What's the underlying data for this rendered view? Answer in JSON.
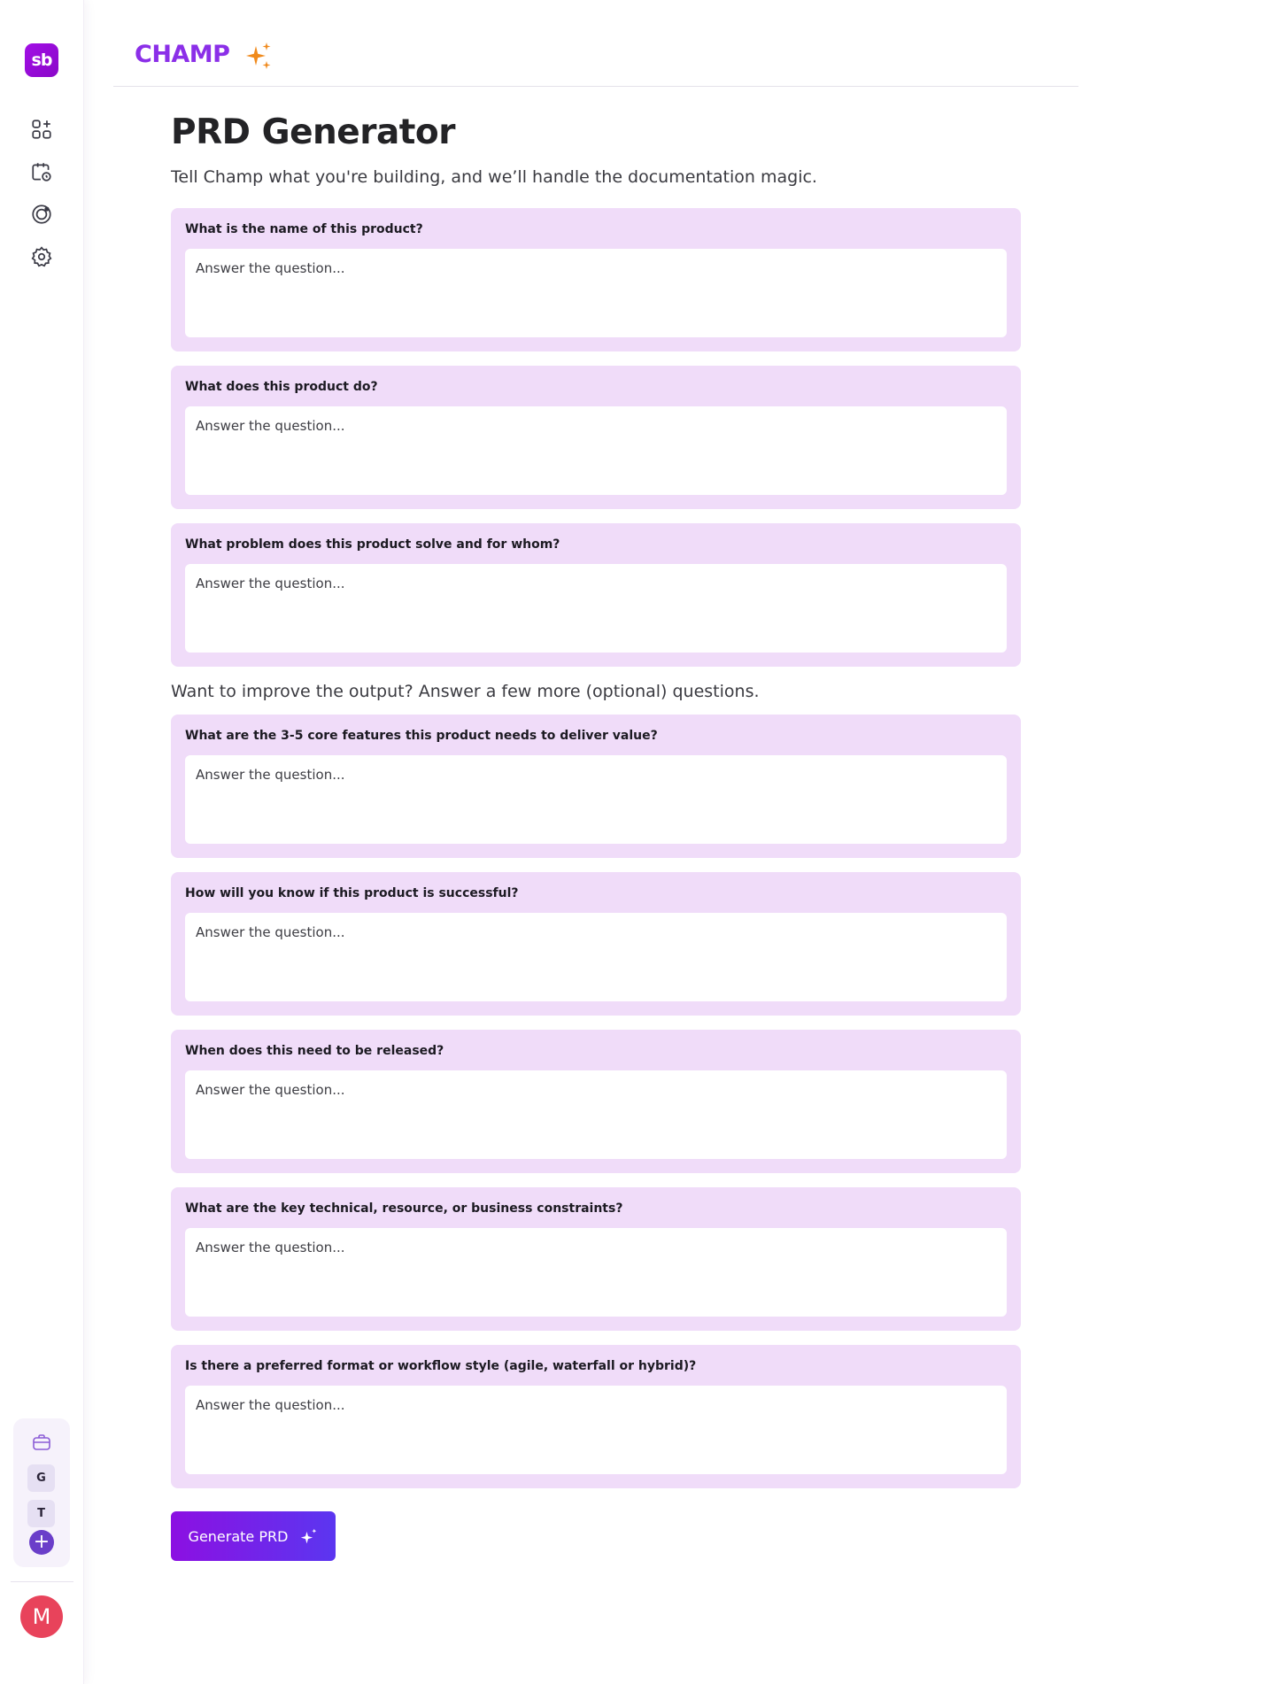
{
  "app": {
    "logo_text": "sb",
    "brand": "CHAMP"
  },
  "sidebar": {
    "nav": [
      {
        "name": "apps-add-icon"
      },
      {
        "name": "calendar-clock-icon"
      },
      {
        "name": "radar-icon"
      },
      {
        "name": "settings-gear-icon"
      }
    ],
    "workspaces": [
      {
        "label": "G"
      },
      {
        "label": "T"
      }
    ],
    "add_label": "+",
    "avatar_initial": "M"
  },
  "page": {
    "title": "PRD Generator",
    "subtitle": "Tell Champ what you're building, and we’ll handle the documentation magic.",
    "optional_note": "Want to improve the output? Answer a few more (optional) questions."
  },
  "questions": [
    {
      "label": "What is the name of this product?",
      "placeholder": "Answer the question..."
    },
    {
      "label": "What does this product do?",
      "placeholder": "Answer the question..."
    },
    {
      "label": "What problem does this product solve and for whom?",
      "placeholder": "Answer the question..."
    },
    {
      "label": "What are the 3-5 core features this product needs to deliver value?",
      "placeholder": "Answer the question..."
    },
    {
      "label": "How will you know if this product is successful?",
      "placeholder": "Answer the question..."
    },
    {
      "label": "When does this need to be released?",
      "placeholder": "Answer the question..."
    },
    {
      "label": "What are the key technical, resource, or business constraints?",
      "placeholder": "Answer the question..."
    },
    {
      "label": "Is there a preferred format or workflow style (agile, waterfall or hybrid)?",
      "placeholder": "Answer the question..."
    }
  ],
  "actions": {
    "generate_label": "Generate PRD"
  },
  "colors": {
    "brand": "#8b2fe8",
    "card_bg": "#f0dcf9",
    "button_start": "#8c10e2",
    "button_end": "#5b36f0",
    "avatar": "#e8435b",
    "spark": "#f08a1c"
  }
}
